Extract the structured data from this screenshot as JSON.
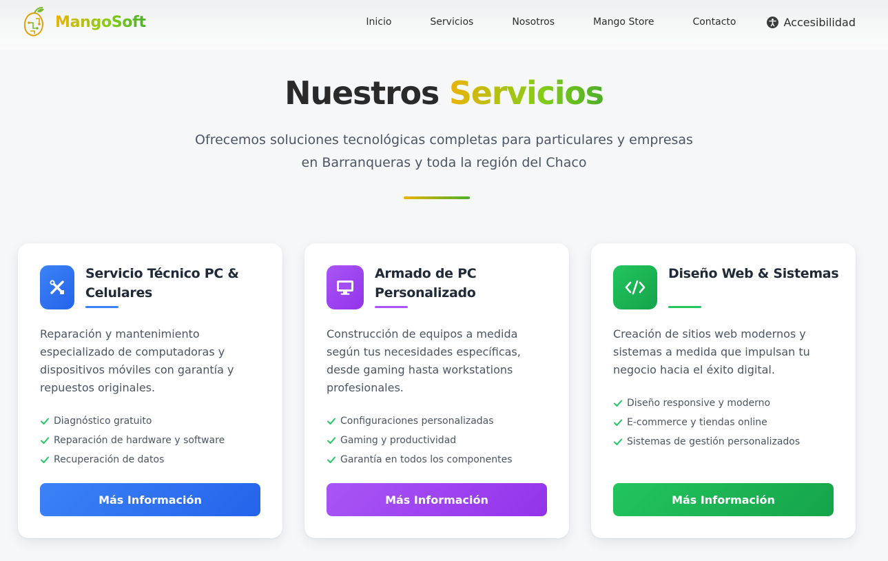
{
  "header": {
    "brand": "MangoSoft",
    "nav": [
      "Inicio",
      "Servicios",
      "Nosotros",
      "Mango Store",
      "Contacto"
    ],
    "accessibility": "Accesibilidad"
  },
  "hero": {
    "title_main": "Nuestros",
    "title_accent": "Servicios",
    "subtitle": "Ofrecemos soluciones tecnológicas completas para particulares y empresas en Barranqueras y toda la región del Chaco"
  },
  "colors": {
    "brand_yellow": "#eab308",
    "brand_green": "#4caf2a",
    "blue": "#3b82f6",
    "purple": "#a855f7",
    "green": "#22c55e",
    "check": "#22c55e"
  },
  "cards": [
    {
      "icon": "tools-icon",
      "title": "Servicio Técnico PC & Celulares",
      "description": "Reparación y mantenimiento especializado de computadoras y dispositivos móviles con garantía y repuestos originales.",
      "features": [
        "Diagnóstico gratuito",
        "Reparación de hardware y software",
        "Recuperación de datos"
      ],
      "button": "Más Información"
    },
    {
      "icon": "monitor-icon",
      "title": "Armado de PC Personalizado",
      "description": "Construcción de equipos a medida según tus necesidades específicas, desde gaming hasta workstations profesionales.",
      "features": [
        "Configuraciones personalizadas",
        "Gaming y productividad",
        "Garantía en todos los componentes"
      ],
      "button": "Más Información"
    },
    {
      "icon": "code-icon",
      "title": "Diseño Web & Sistemas",
      "description": "Creación de sitios web modernos y sistemas a medida que impulsan tu negocio hacia el éxito digital.",
      "features": [
        "Diseño responsive y moderno",
        "E-commerce y tiendas online",
        "Sistemas de gestión personalizados"
      ],
      "button": "Más Información"
    }
  ]
}
